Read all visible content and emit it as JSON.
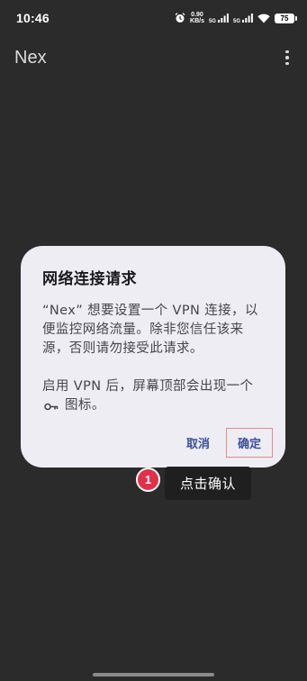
{
  "status_bar": {
    "time": "10:46",
    "speed_value": "0.90",
    "speed_unit": "KB/s",
    "sim1_label": "5G",
    "sim2_label": "5G",
    "battery": "75"
  },
  "app_bar": {
    "title": "Nex"
  },
  "dialog": {
    "title": "网络连接请求",
    "body_1": "“Nex” 想要设置一个 VPN 连接，以便监控网络流量。除非您信任该来源，否则请勿接受此请求。",
    "body_2_before": "启用 VPN 后，屏幕顶部会出现一个",
    "body_2_after": "图标。",
    "cancel_label": "取消",
    "ok_label": "确定"
  },
  "tip": {
    "badge_number": "1",
    "label": "点击确认"
  },
  "colors": {
    "background": "#2b2b2b",
    "dialog_background": "#eeedf3",
    "button_text": "#3a4f9a",
    "highlight_border": "#e38a8a",
    "badge": "#e0304a"
  }
}
